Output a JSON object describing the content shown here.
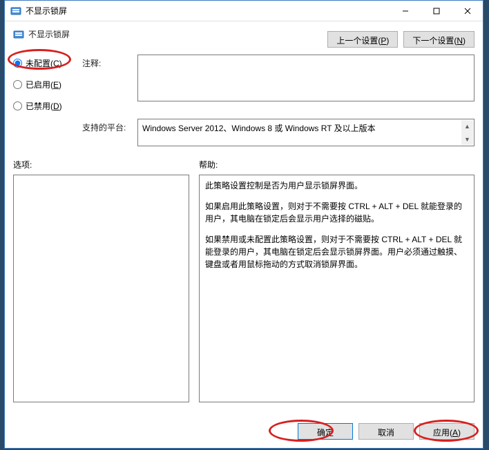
{
  "window": {
    "title": "不显示锁屏",
    "minimize": "—",
    "maximize": "□",
    "close": "✕"
  },
  "header": {
    "title": "不显示锁屏",
    "prev_btn": "上一个设置(",
    "prev_key": "P",
    "prev_btn_suffix": ")",
    "next_btn": "下一个设置(",
    "next_key": "N",
    "next_btn_suffix": ")"
  },
  "radios": {
    "not_configured": "未配置(",
    "not_configured_key": "C",
    "not_configured_suffix": ")",
    "enabled": "已启用(",
    "enabled_key": "E",
    "enabled_suffix": ")",
    "disabled": "已禁用(",
    "disabled_key": "D",
    "disabled_suffix": ")"
  },
  "labels": {
    "comment": "注释:",
    "platform": "支持的平台:",
    "options": "选项:",
    "help": "帮助:"
  },
  "platform_text": "Windows Server 2012、Windows 8 或 Windows RT 及以上版本",
  "help": {
    "p1": "此策略设置控制是否为用户显示锁屏界面。",
    "p2": "如果启用此策略设置，则对于不需要按 CTRL + ALT + DEL  就能登录的用户，其电脑在锁定后会显示用户选择的磁贴。",
    "p3": "如果禁用或未配置此策略设置，则对于不需要按 CTRL + ALT + DEL 就能登录的用户，其电脑在锁定后会显示锁屏界面。用户必须通过触摸、键盘或者用鼠标拖动的方式取消锁屏界面。"
  },
  "footer": {
    "ok": "确定",
    "cancel": "取消",
    "apply": "应用(",
    "apply_key": "A",
    "apply_suffix": ")"
  }
}
